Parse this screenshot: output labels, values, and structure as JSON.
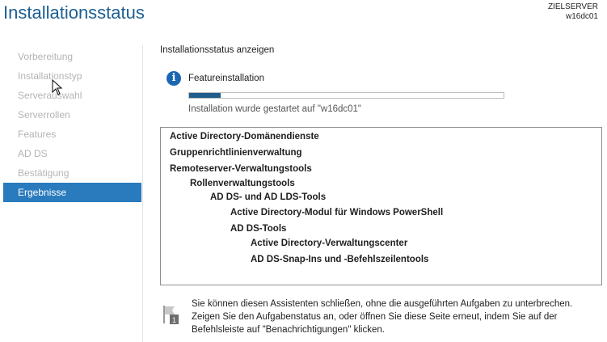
{
  "window": {
    "title": "Installationsstatus"
  },
  "server": {
    "label": "ZIELSERVER",
    "name": "w16dc01"
  },
  "sidebar": {
    "items": [
      {
        "label": "Vorbereitung",
        "active": false
      },
      {
        "label": "Installationstyp",
        "active": false
      },
      {
        "label": "Serverauswahl",
        "active": false
      },
      {
        "label": "Serverrollen",
        "active": false
      },
      {
        "label": "Features",
        "active": false
      },
      {
        "label": "AD DS",
        "active": false
      },
      {
        "label": "Bestätigung",
        "active": false
      },
      {
        "label": "Ergebnisse",
        "active": true
      }
    ]
  },
  "main": {
    "section_label": "Installationsstatus anzeigen",
    "feature_label": "Featureinstallation",
    "progress_percent": 10,
    "status_text": "Installation wurde gestartet auf \"w16dc01\"",
    "results": [
      {
        "text": "Active Directory-Domänendienste",
        "level": 0
      },
      {
        "text": "Gruppenrichtlinienverwaltung",
        "level": 0
      },
      {
        "text": "Remoteserver-Verwaltungstools",
        "level": 0
      },
      {
        "text": "Rollenverwaltungstools",
        "level": 1
      },
      {
        "text": "AD DS- und AD LDS-Tools",
        "level": 2
      },
      {
        "text": "Active Directory-Modul für Windows PowerShell",
        "level": 3
      },
      {
        "text": "AD DS-Tools",
        "level": 3
      },
      {
        "text": "Active Directory-Verwaltungscenter",
        "level": 4
      },
      {
        "text": "AD DS-Snap-Ins und -Befehlszeilentools",
        "level": 4
      }
    ],
    "footer": {
      "flag_badge": "1",
      "lines": [
        "Sie können diesen Assistenten schließen, ohne die ausgeführten Aufgaben zu unterbrechen.",
        "Zeigen Sie den Aufgabenstatus an, oder öffnen Sie diese Seite erneut, indem Sie auf der",
        "Befehlsleiste auf \"Benachrichtigungen\" klicken."
      ]
    }
  },
  "colors": {
    "title": "#1c5f93",
    "active_nav": "#2a7bbd",
    "progress_fill": "#1f5d8c",
    "info_icon": "#1a66b3"
  }
}
